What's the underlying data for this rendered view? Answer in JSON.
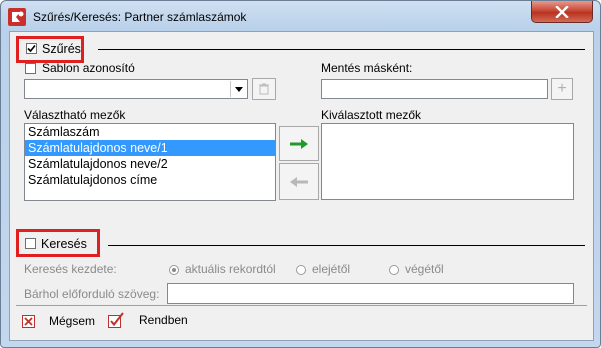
{
  "window": {
    "title": "Szűrés/Keresés: Partner számlaszámok"
  },
  "filter": {
    "section_label": "Szűrés",
    "template_id_label": "Sablon azonosító",
    "save_as_label": "Mentés másként:",
    "add_button_label": "+",
    "available_fields_label": "Választható mezők",
    "selected_fields_label": "Kiválasztott mezők",
    "available_fields": [
      "Számlaszám",
      "Számlatulajdonos neve/1",
      "Számlatulajdonos neve/2",
      "Számlatulajdonos címe"
    ],
    "selected_index": 1
  },
  "search": {
    "section_label": "Keresés",
    "start_label": "Keresés kezdete:",
    "options": [
      "aktuális rekordtól",
      "elejétől",
      "végétől"
    ],
    "anywhere_label": "Bárhol előforduló szöveg:"
  },
  "footer": {
    "cancel_label": "Mégsem",
    "ok_label": "Rendben"
  },
  "colors": {
    "highlight": "#e02020",
    "selection": "#3399ff",
    "arrow_green": "#1f9a2c"
  }
}
